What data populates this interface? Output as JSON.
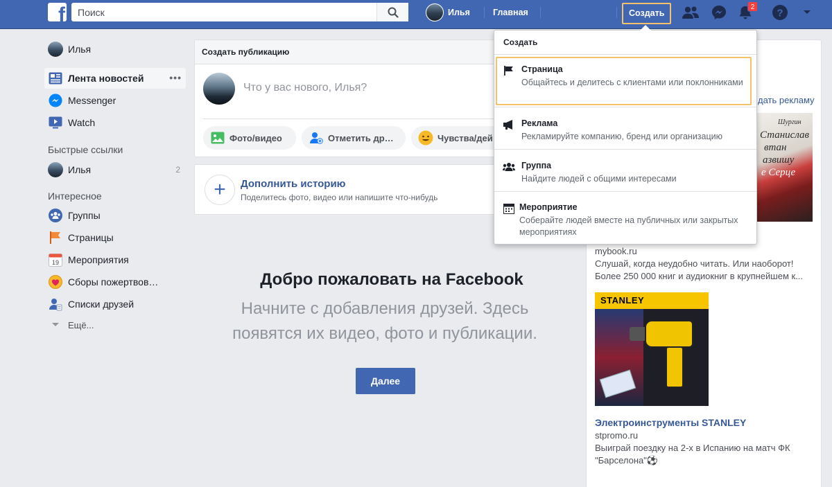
{
  "topbar": {
    "logo_letter": "f",
    "search_placeholder": "Поиск",
    "profile_name": "Илья",
    "nav_home": "Главная",
    "nav_find_friends": "Найти друзей",
    "nav_create": "Создать",
    "notifications_count": "2",
    "brand_color": "#4267b2"
  },
  "left_nav": {
    "profile": "Илья",
    "items": [
      {
        "label": "Лента новостей",
        "icon": "news-feed-icon",
        "active": true
      },
      {
        "label": "Messenger",
        "icon": "messenger-icon"
      },
      {
        "label": "Watch",
        "icon": "watch-icon"
      }
    ],
    "more_dots": "•••",
    "quick_links_title": "Быстрые ссылки",
    "quick_links": [
      {
        "label": "Илья",
        "count": "2"
      }
    ],
    "interests_title": "Интересное",
    "interests": [
      {
        "label": "Группы",
        "icon": "groups-icon"
      },
      {
        "label": "Страницы",
        "icon": "pages-flag-icon"
      },
      {
        "label": "Мероприятия",
        "icon": "events-calendar-icon",
        "day": "19"
      },
      {
        "label": "Сборы пожертвов…",
        "icon": "fundraiser-icon"
      },
      {
        "label": "Списки друзей",
        "icon": "friend-lists-icon"
      }
    ],
    "more_link": "Ещё..."
  },
  "composer": {
    "header": "Создать публикацию",
    "placeholder": "Что у вас нового, Илья?",
    "buttons": [
      {
        "label": "Фото/видео",
        "icon": "photo-icon"
      },
      {
        "label": "Отметить др…",
        "icon": "tag-friends-icon"
      },
      {
        "label": "Чувства/дей…",
        "icon": "feeling-emoji-icon"
      }
    ]
  },
  "story": {
    "title": "Дополнить историю",
    "subtitle": "Поделитесь фото, видео или напишите что-нибудь"
  },
  "welcome": {
    "title": "Добро пожаловать на Facebook",
    "subtitle": "Начните с добавления друзей. Здесь появятся их видео, фото и публикации.",
    "button": "Далее"
  },
  "create_menu": {
    "title": "Создать",
    "items": [
      {
        "title": "Страница",
        "desc": "Общайтесь и делитесь с клиентами или поклонниками",
        "icon": "flag-icon"
      },
      {
        "title": "Реклама",
        "desc": "Рекламируйте компанию, бренд или организацию",
        "icon": "megaphone-icon"
      },
      {
        "title": "Группа",
        "desc": "Найдите людей с общими интересами",
        "icon": "group-people-icon"
      },
      {
        "title": "Мероприятие",
        "desc": "Соберайте людей вместе на публичных или закрытых мероприятиях",
        "icon": "event-calendar-icon"
      }
    ]
  },
  "ads": {
    "create_ad_link": "дать рекламу",
    "ad1": {
      "book_text_1": "Шургин",
      "book_text_2": "Станислав",
      "book_text_3": "втан",
      "book_text_4": "азвишу",
      "book_text_5": "е Серце",
      "domain": "mybook.ru",
      "line1": "Слушай, когда неудобно читать. Или наоборот!",
      "line2": "Более 250 000 книг и аудиокниг в крупнейшем к..."
    },
    "ad2": {
      "brand": "STANLEY",
      "title": "Электроинструменты STANLEY",
      "domain": "stpromo.ru",
      "line1": "Выиграй поездку на 2-х в Испанию на матч ФК",
      "line2": "\"Барселона\"⚽"
    }
  }
}
